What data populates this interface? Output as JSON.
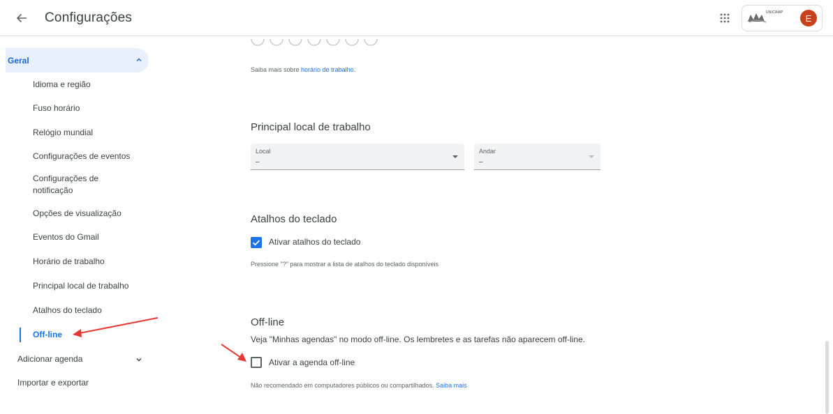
{
  "header": {
    "title": "Configurações",
    "back_icon": "arrow-left-icon",
    "apps_icon": "apps-grid-icon",
    "org_logo_text": "UNICAMP",
    "avatar_letter": "E",
    "avatar_color": "#c5421a"
  },
  "sidebar": {
    "geral_label": "Geral",
    "items": [
      "Idioma e região",
      "Fuso horário",
      "Relógio mundial",
      "Configurações de eventos",
      "Configurações de notificação",
      "Opções de visualização",
      "Eventos do Gmail",
      "Horário de trabalho",
      "Principal local de trabalho",
      "Atalhos do teclado",
      "Off-line"
    ],
    "active_item": "Off-line",
    "add_calendar": "Adicionar agenda",
    "import_export": "Importar e exportar"
  },
  "main": {
    "working_hours_prefix": "Saiba mais sobre ",
    "working_hours_link": "horário de trabalho",
    "working_hours_suffix": ".",
    "workplace": {
      "title": "Principal local de trabalho",
      "local_label": "Local",
      "local_value": "–",
      "andar_label": "Andar",
      "andar_value": "–"
    },
    "shortcuts": {
      "title": "Atalhos do teclado",
      "checkbox_label": "Ativar atalhos do teclado",
      "checked": true,
      "hint": "Pressione \"?\" para mostrar a lista de atalhos do teclado disponíveis"
    },
    "offline": {
      "title": "Off-line",
      "description": "Veja \"Minhas agendas\" no modo off-line. Os lembretes e as tarefas não aparecem off-line.",
      "checkbox_label": "Ativar a agenda off-line",
      "checked": false,
      "note": "Não recomendado em computadores públicos ou compartilhados. ",
      "note_link": "Saiba mais"
    }
  },
  "colors": {
    "accent": "#1a73e8",
    "annotation_arrow": "#e53935"
  }
}
